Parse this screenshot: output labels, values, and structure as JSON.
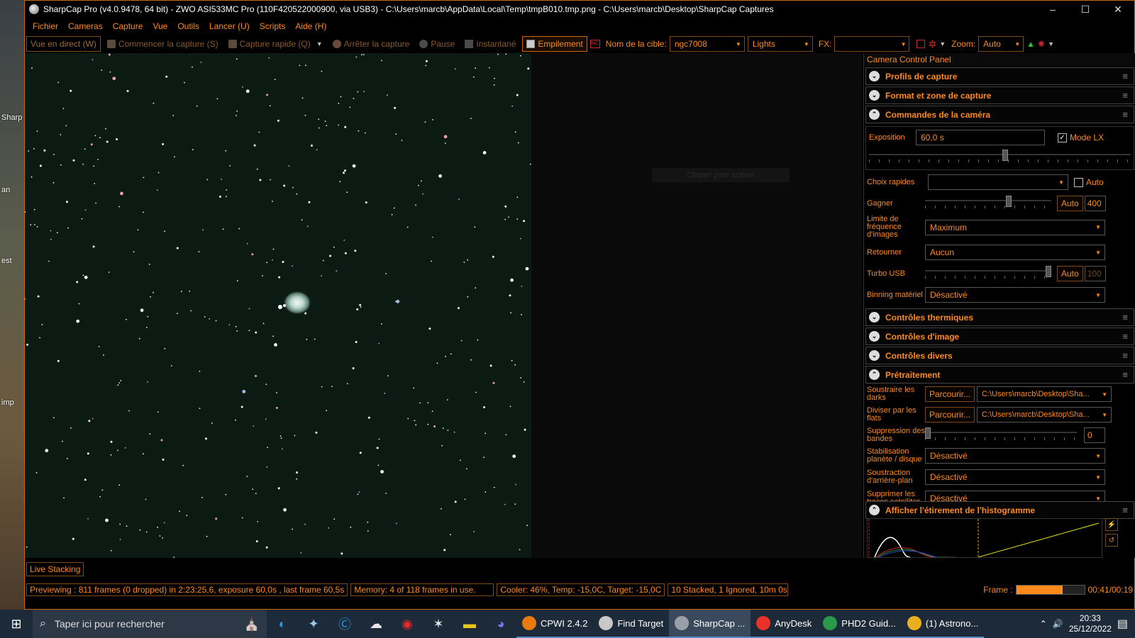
{
  "window": {
    "title": "SharpCap Pro (v4.0.9478, 64 bit) - ZWO ASI533MC Pro (110F420522000900, via USB3) - C:\\Users\\marcb\\AppData\\Local\\Temp\\tmpB010.tmp.png - C:\\Users\\marcb\\Desktop\\SharpCap Captures",
    "minimize": "–",
    "maximize": "☐",
    "close": "✕"
  },
  "desktop": {
    "labels": [
      "Sharp",
      "an",
      "est",
      "imp"
    ]
  },
  "menu": [
    "Fichier",
    "Cameras",
    "Capture",
    "Vue",
    "Outils",
    "Lancer (U)",
    "Scripts",
    "Aide (H)"
  ],
  "toolbar": {
    "live_view": "Vue en direct (W)",
    "start_capture": "Commencer la capture (S)",
    "quick_capture": "Capture rapide (Q)",
    "stop_capture": "Arrêter la capture",
    "pause": "Pause",
    "snapshot": "Instantané",
    "stacking": "Empilement",
    "target_label": "Nom de la cible:",
    "target_value": "ngc7008",
    "frame_type": "Lights",
    "fx_label": "FX:",
    "fx_value": "",
    "zoom_label": "Zoom:",
    "zoom_value": "Auto"
  },
  "image": {
    "hint": "Cliquer pour activer",
    "live_stacking": "Live Stacking"
  },
  "panel": {
    "title": "Camera Control Panel",
    "sections": {
      "profiles": "Profils de capture",
      "format": "Format et zone de capture",
      "camera": "Commandes de la caméra",
      "thermal": "Contrôles thermiques",
      "image_ctrl": "Contrôles d'image",
      "misc": "Contrôles divers",
      "preprocess": "Prétraitement",
      "histogram": "Afficher l'étirement de l'histogramme"
    },
    "camera": {
      "exposure_label": "Exposition",
      "exposure_value": "60,0 s",
      "lx_mode": "Mode LX",
      "lx_checked": true,
      "quick_label": "Choix rapides",
      "quick_value": "",
      "quick_auto": "Auto",
      "gain_label": "Gagner",
      "gain_auto": "Auto",
      "gain_value": "400",
      "framerate_label": "Limite de fréquence d'images",
      "framerate_value": "Maximum",
      "flip_label": "Retourner",
      "flip_value": "Aucun",
      "usb_label": "Turbo USB",
      "usb_auto": "Auto",
      "usb_value": "100",
      "binning_label": "Binning matériel",
      "binning_value": "Désactivé"
    },
    "preprocess": {
      "darks_label": "Soustraire les darks",
      "darks_button": "Parcourir...",
      "darks_value": "C:\\Users\\marcb\\Desktop\\Sha...",
      "flats_label": "Diviser par les flats",
      "flats_button": "Parcourir...",
      "flats_value": "C:\\Users\\marcb\\Desktop\\Sha...",
      "banding_label": "Suppression des bandes",
      "banding_value": "0",
      "stabilize_label": "Stabilisation planète / disque",
      "stabilize_value": "Désactivé",
      "background_label": "Soustraction d'arrière-plan",
      "background_value": "Désactivé",
      "satellite_label": "Supprimer les traces satellites",
      "satellite_value": "Désactivé"
    }
  },
  "status": {
    "preview": "Previewing : 811 frames (0 dropped) in 2:23:25,6, exposure 60,0s , last frame 60,5s",
    "memory": "Memory: 4 of 118 frames in use.",
    "cooler": "Cooler: 46%, Temp: -15,0C, Target: -15,0C",
    "stacked": "10 Stacked, 1 Ignored, 10m 0s",
    "frame_label": "Frame :",
    "frame_progress": 0.68,
    "frame_time": "00:41/00:19"
  },
  "taskbar": {
    "search_placeholder": "Taper ici pour rechercher",
    "apps": [
      {
        "label": "CPWI 2.4.2",
        "color": "#e87a10"
      },
      {
        "label": "Find Target",
        "color": "#c8c8c8"
      },
      {
        "label": "SharpCap ...",
        "color": "#9aa0a8"
      },
      {
        "label": "AnyDesk",
        "color": "#e8322a"
      },
      {
        "label": "PHD2 Guid...",
        "color": "#2a9a4a"
      },
      {
        "label": "(1) Astrono...",
        "color": "#e8b020"
      }
    ],
    "time": "20:33",
    "date": "25/12/2022"
  }
}
